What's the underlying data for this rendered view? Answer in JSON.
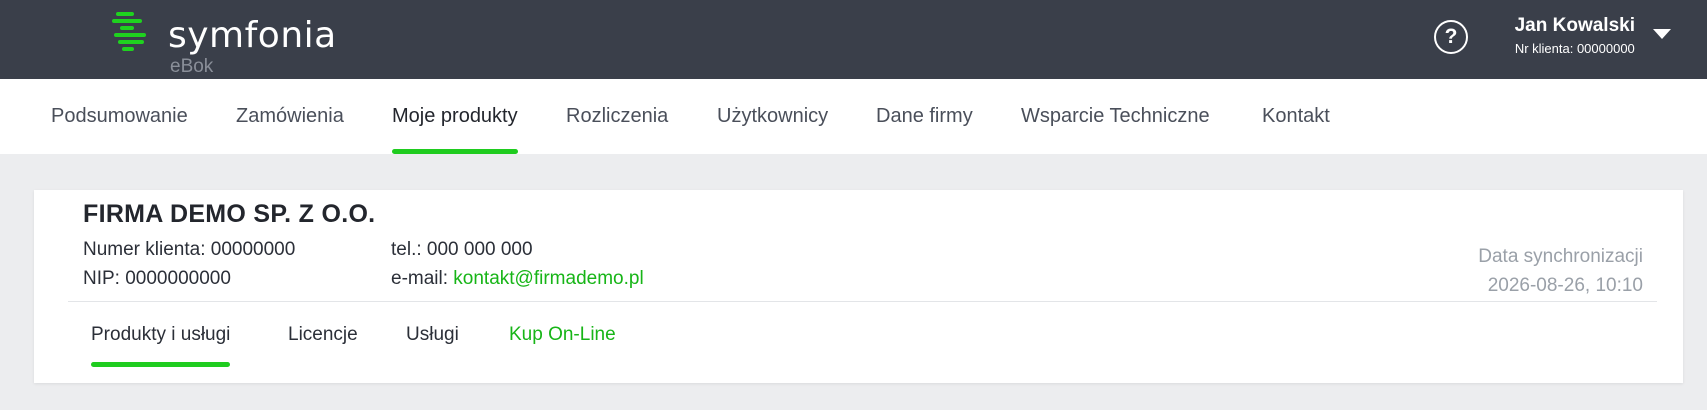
{
  "header": {
    "logo_text": "symfonia",
    "logo_sub": "eBok",
    "logo_icon": "symfonia-logo-icon",
    "help_icon": "question-circle-icon",
    "help_glyph": "?",
    "user": {
      "name": "Jan Kowalski",
      "client_id": "Nr klienta: 00000000",
      "caret_icon": "caret-down-icon"
    }
  },
  "nav": {
    "items": [
      {
        "label": "Podsumowanie"
      },
      {
        "label": "Zamówienia"
      },
      {
        "label": "Moje produkty",
        "active": true
      },
      {
        "label": "Rozliczenia"
      },
      {
        "label": "Użytkownicy"
      },
      {
        "label": "Dane firmy"
      },
      {
        "label": "Wsparcie Techniczne"
      },
      {
        "label": "Kontakt"
      }
    ]
  },
  "company": {
    "name": "FIRMA DEMO SP. Z O.O.",
    "client_number": "Numer klienta: 00000000",
    "nip": "NIP: 0000000000",
    "phone": "tel.: 000 000 000",
    "email_label": "e-mail:",
    "email": "kontakt@firmademo.pl",
    "sync_label": "Data synchronizacji",
    "sync_date": "2026-08-26, 10:10"
  },
  "subnav": {
    "items": [
      {
        "label": "Produkty i usługi",
        "active": true
      },
      {
        "label": "Licencje"
      },
      {
        "label": "Usługi"
      },
      {
        "label": "Kup On-Line",
        "highlight": true
      }
    ]
  },
  "colors": {
    "topbar": "#3a3f4a",
    "accent": "#1fcc1f",
    "link": "#17b517",
    "background": "#ecedef"
  }
}
